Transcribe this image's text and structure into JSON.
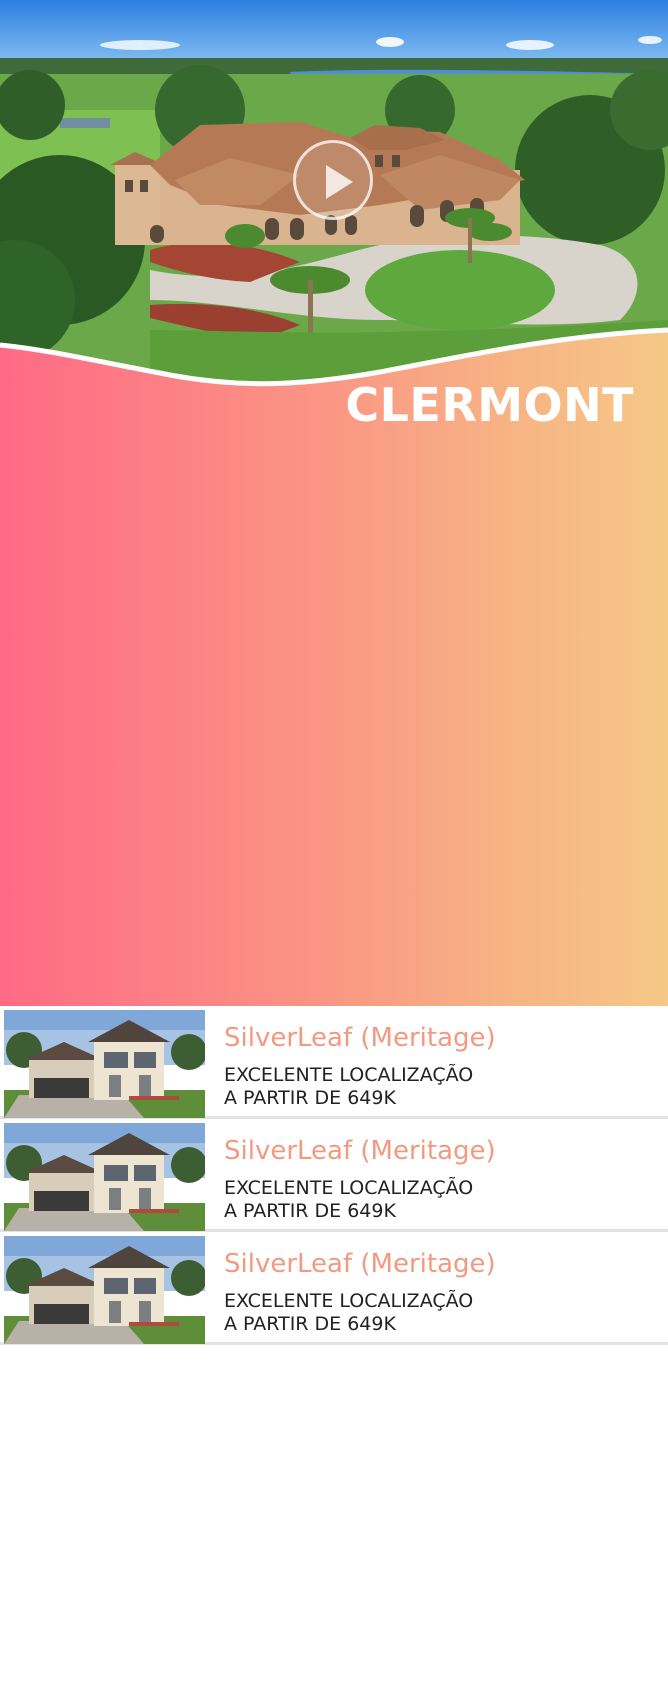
{
  "hero": {
    "city": "CLERMONT",
    "media": "aerial-photo-of-mansion-with-lake",
    "play_icon": "play-icon"
  },
  "listings": [
    {
      "name": "SilverLeaf (Meritage)",
      "line1": "EXCELENTE LOCALIZAÇÃO",
      "line2": "A PARTIR DE 649K"
    },
    {
      "name": "SilverLeaf (Meritage)",
      "line1": "EXCELENTE LOCALIZAÇÃO",
      "line2": "A PARTIR DE 649K"
    },
    {
      "name": "SilverLeaf (Meritage)",
      "line1": "EXCELENTE LOCALIZAÇÃO",
      "line2": "A PARTIR DE 649K"
    }
  ],
  "colors": {
    "gradient_start": "#ff6a85",
    "gradient_end": "#f5c887",
    "listing_name": "#f29a80"
  }
}
